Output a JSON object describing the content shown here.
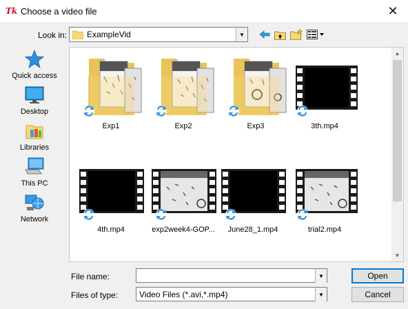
{
  "window": {
    "title": "Choose a video file",
    "app_icon_text": "Tk"
  },
  "lookin": {
    "label": "Look in:",
    "value": "ExampleVid"
  },
  "toolbar": [
    "back-arrow-icon",
    "up-folder-icon",
    "new-folder-icon",
    "view-menu-icon"
  ],
  "places": [
    {
      "label": "Quick access",
      "icon": "quick-access-star-icon"
    },
    {
      "label": "Desktop",
      "icon": "desktop-icon"
    },
    {
      "label": "Libraries",
      "icon": "libraries-icon"
    },
    {
      "label": "This PC",
      "icon": "this-pc-icon"
    },
    {
      "label": "Network",
      "icon": "network-icon"
    }
  ],
  "files": [
    {
      "name": "Exp1",
      "kind": "folder"
    },
    {
      "name": "Exp2",
      "kind": "folder"
    },
    {
      "name": "Exp3",
      "kind": "folder"
    },
    {
      "name": "3th.mp4",
      "kind": "video-dark"
    },
    {
      "name": "4th.mp4",
      "kind": "video-dark"
    },
    {
      "name": "exp2week4-GOP...",
      "kind": "video-frame"
    },
    {
      "name": "June28_1.mp4",
      "kind": "video-dark"
    },
    {
      "name": "trial2.mp4",
      "kind": "video-frame"
    }
  ],
  "filename": {
    "label": "File name:",
    "value": ""
  },
  "filetype": {
    "label": "Files of type:",
    "value": "Video Files (*.avi,*.mp4)"
  },
  "buttons": {
    "open": "Open",
    "cancel": "Cancel"
  },
  "colors": {
    "accent": "#0078d7",
    "folder": "#f8d775",
    "app_icon": "#c8102e"
  }
}
